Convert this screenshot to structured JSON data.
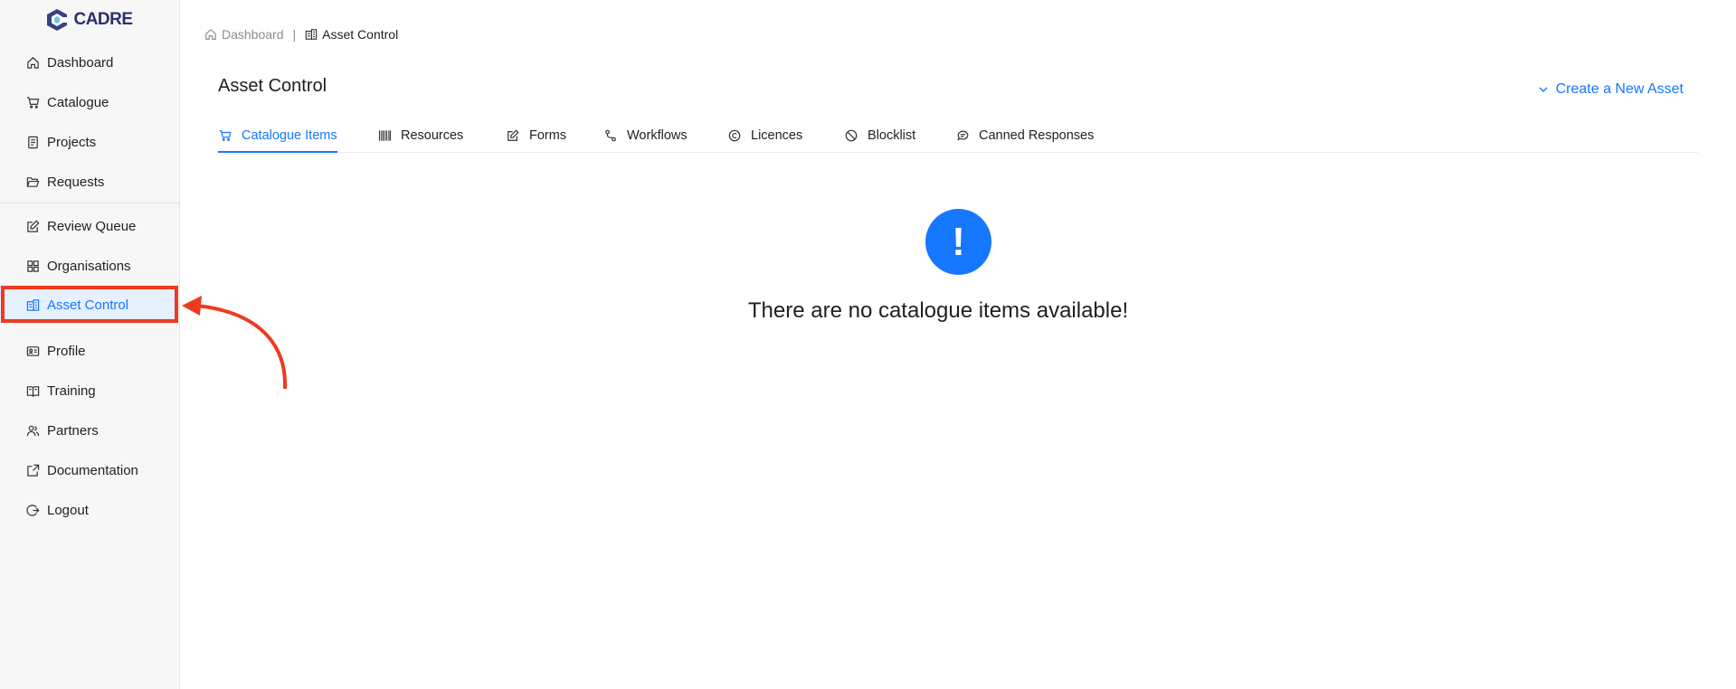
{
  "app": {
    "logo_text": "CADRE"
  },
  "sidebar": {
    "items": [
      {
        "label": "Dashboard",
        "icon": "home-icon"
      },
      {
        "label": "Catalogue",
        "icon": "cart-icon"
      },
      {
        "label": "Projects",
        "icon": "document-icon"
      },
      {
        "label": "Requests",
        "icon": "folder-open-icon"
      },
      {
        "label": "Review Queue",
        "icon": "edit-icon"
      },
      {
        "label": "Organisations",
        "icon": "grid-icon"
      },
      {
        "label": "Asset Control",
        "icon": "building-icon",
        "active": true
      },
      {
        "label": "Profile",
        "icon": "id-card-icon"
      },
      {
        "label": "Training",
        "icon": "book-icon"
      },
      {
        "label": "Partners",
        "icon": "partners-icon"
      },
      {
        "label": "Documentation",
        "icon": "external-edit-icon"
      },
      {
        "label": "Logout",
        "icon": "logout-icon"
      }
    ]
  },
  "breadcrumb": {
    "home": "Dashboard",
    "separator": "|",
    "current": "Asset Control"
  },
  "main": {
    "title": "Asset Control",
    "create_label": "Create a New Asset",
    "tabs": [
      {
        "label": "Catalogue Items",
        "icon": "cart-icon",
        "active": true
      },
      {
        "label": "Resources",
        "icon": "barcode-icon"
      },
      {
        "label": "Forms",
        "icon": "edit-icon"
      },
      {
        "label": "Workflows",
        "icon": "workflow-icon"
      },
      {
        "label": "Licences",
        "icon": "copyright-icon"
      },
      {
        "label": "Blocklist",
        "icon": "stop-icon"
      },
      {
        "label": "Canned Responses",
        "icon": "chat-icon"
      }
    ],
    "empty_symbol": "!",
    "empty_message": "There are no catalogue items available!"
  },
  "colors": {
    "accent": "#1677ff",
    "highlight": "#ee3a1f",
    "sidebar_bg": "#f7f7f7"
  }
}
